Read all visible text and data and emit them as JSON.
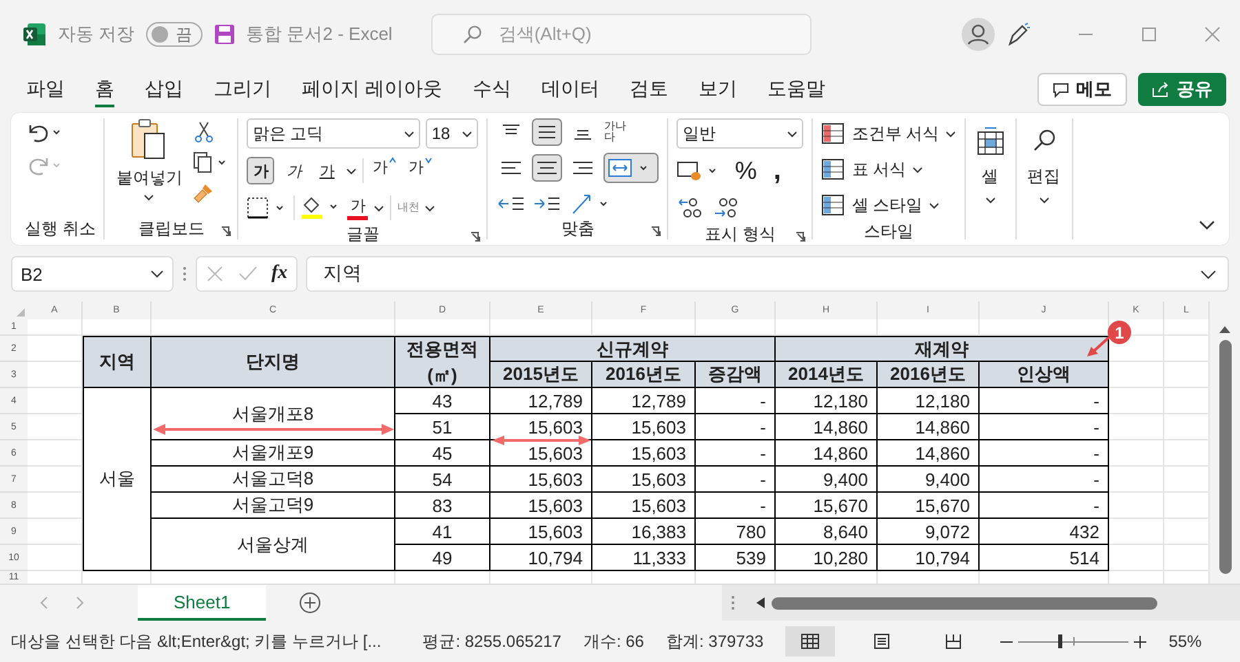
{
  "title_bar": {
    "autosave_label": "자동 저장",
    "autosave_toggle": {
      "text": "끔",
      "on": false
    },
    "document": "통합 문서2  -  Excel",
    "search": {
      "placeholder": "검색(Alt+Q)"
    }
  },
  "menu_tabs": [
    {
      "label": "파일",
      "selected": false
    },
    {
      "label": "홈",
      "selected": true
    },
    {
      "label": "삽입",
      "selected": false
    },
    {
      "label": "그리기",
      "selected": false
    },
    {
      "label": "페이지 레이아웃",
      "selected": false
    },
    {
      "label": "수식",
      "selected": false
    },
    {
      "label": "데이터",
      "selected": false
    },
    {
      "label": "검토",
      "selected": false
    },
    {
      "label": "보기",
      "selected": false
    },
    {
      "label": "도움말",
      "selected": false
    }
  ],
  "menu_buttons": {
    "comments": "메모",
    "share": "공유"
  },
  "ribbon": [
    {
      "kind": "undo",
      "label": "실행 취소"
    },
    {
      "kind": "clipboard",
      "label": "클립보드",
      "paste": "붙여넣기"
    },
    {
      "kind": "font",
      "label": "글꼴",
      "font": "맑은 고딕",
      "size": "18",
      "styles": [
        {
          "text": "가",
          "kind": "bold",
          "on": true
        },
        {
          "text": "가",
          "kind": "italic",
          "on": false
        },
        {
          "text": "가",
          "kind": "underline",
          "on": false
        }
      ],
      "grow": "가",
      "shrink": "가",
      "font_color": "가",
      "phonetic": "내천"
    },
    {
      "kind": "align",
      "label": "맞춤",
      "wrap": "가나다",
      "vertical": [
        {
          "on": false
        },
        {
          "on": true
        },
        {
          "on": false
        }
      ],
      "horizontal": [
        {
          "on": false
        },
        {
          "on": true
        },
        {
          "on": false
        }
      ],
      "merge_on": true
    },
    {
      "kind": "number",
      "label": "표시 형식",
      "format": "일반",
      "percent": "%",
      "comma": ","
    },
    {
      "kind": "styles",
      "label": "스타일",
      "items": [
        "조건부 서식",
        "표 서식",
        "셀 스타일"
      ]
    },
    {
      "kind": "cells",
      "button": "셀"
    },
    {
      "kind": "editing",
      "button": "편집"
    }
  ],
  "formula_bar": {
    "name_box": "B2",
    "fx": "fx",
    "value": "지역"
  },
  "sheet": {
    "columns": [
      "A",
      "B",
      "C",
      "D",
      "E",
      "F",
      "G",
      "H",
      "I",
      "J",
      "K",
      "L"
    ],
    "row_numbers": [
      "1",
      "2",
      "3",
      "4",
      "5",
      "6",
      "7",
      "8",
      "9",
      "10",
      "11"
    ],
    "table": {
      "region_header": "지역",
      "complex_header": "단지명",
      "area_header": "전용면적 (㎡)",
      "groups": [
        {
          "label": "신규계약",
          "columns": [
            "2015년도",
            "2016년도",
            "증감액"
          ]
        },
        {
          "label": "재계약",
          "columns": [
            "2014년도",
            "2016년도",
            "인상액"
          ]
        }
      ],
      "regions": [
        {
          "name": "서울",
          "complexes": [
            {
              "name": "서울개포8",
              "rows": [
                [
                  "43",
                  "12,789",
                  "12,789",
                  "-",
                  "12,180",
                  "12,180",
                  "-"
                ],
                [
                  "51",
                  "15,603",
                  "15,603",
                  "-",
                  "14,860",
                  "14,860",
                  "-"
                ]
              ]
            },
            {
              "name": "서울개포9",
              "rows": [
                [
                  "45",
                  "15,603",
                  "15,603",
                  "-",
                  "14,860",
                  "14,860",
                  "-"
                ]
              ]
            },
            {
              "name": "서울고덕8",
              "rows": [
                [
                  "54",
                  "15,603",
                  "15,603",
                  "-",
                  "9,400",
                  "9,400",
                  "-"
                ]
              ]
            },
            {
              "name": "서울고덕9",
              "rows": [
                [
                  "83",
                  "15,603",
                  "15,603",
                  "-",
                  "15,670",
                  "15,670",
                  "-"
                ]
              ]
            },
            {
              "name": "서울상계",
              "rows": [
                [
                  "41",
                  "15,603",
                  "16,383",
                  "780",
                  "8,640",
                  "9,072",
                  "432"
                ],
                [
                  "49",
                  "10,794",
                  "11,333",
                  "539",
                  "10,280",
                  "10,794",
                  "514"
                ]
              ]
            }
          ]
        }
      ]
    },
    "callout": "1"
  },
  "sheet_tabs": [
    {
      "label": "Sheet1",
      "selected": true
    }
  ],
  "status_bar": {
    "message": "대상을 선택한 다음 &lt;Enter&gt; 키를 누르거나 [...",
    "average": "평균: 8255.065217",
    "count": "개수: 66",
    "sum": "합계: 379733",
    "zoom_slider": {
      "level": 0.37
    },
    "zoom": "55%"
  }
}
